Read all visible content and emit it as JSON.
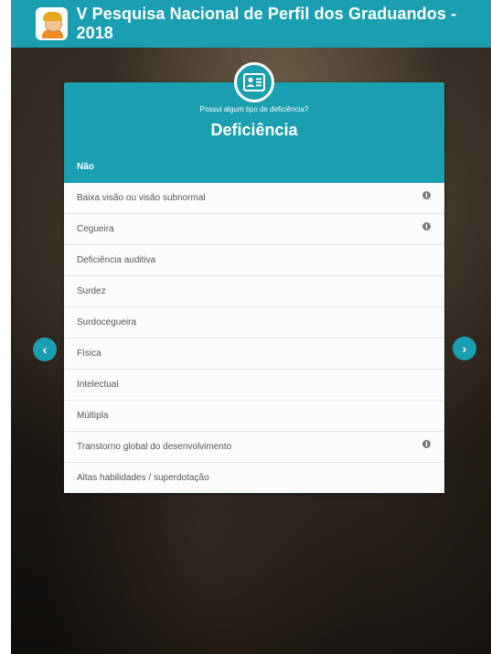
{
  "header": {
    "title": "V Pesquisa Nacional de Perfil dos Graduandos - 2018",
    "logo_icon": "student-avatar-icon"
  },
  "card": {
    "icon": "id-card-icon",
    "question": "Possui algum tipo de deficiência?",
    "title": "Deficiência",
    "options": [
      {
        "label": "Não",
        "selected": true,
        "info": false
      },
      {
        "label": "Baixa visão ou visão subnormal",
        "selected": false,
        "info": true
      },
      {
        "label": "Cegueira",
        "selected": false,
        "info": true
      },
      {
        "label": "Deficiência auditiva",
        "selected": false,
        "info": false
      },
      {
        "label": "Surdez",
        "selected": false,
        "info": false
      },
      {
        "label": "Surdocegueira",
        "selected": false,
        "info": false
      },
      {
        "label": "Física",
        "selected": false,
        "info": false
      },
      {
        "label": "Intelectual",
        "selected": false,
        "info": false
      },
      {
        "label": "Múltipla",
        "selected": false,
        "info": false
      },
      {
        "label": "Transtorno global do desenvolvimento",
        "selected": false,
        "info": true
      },
      {
        "label": "Altas habilidades / superdotação",
        "selected": false,
        "info": false
      }
    ]
  },
  "nav": {
    "prev_symbol": "‹",
    "next_symbol": "›"
  },
  "colors": {
    "accent": "#1a9fb0"
  }
}
